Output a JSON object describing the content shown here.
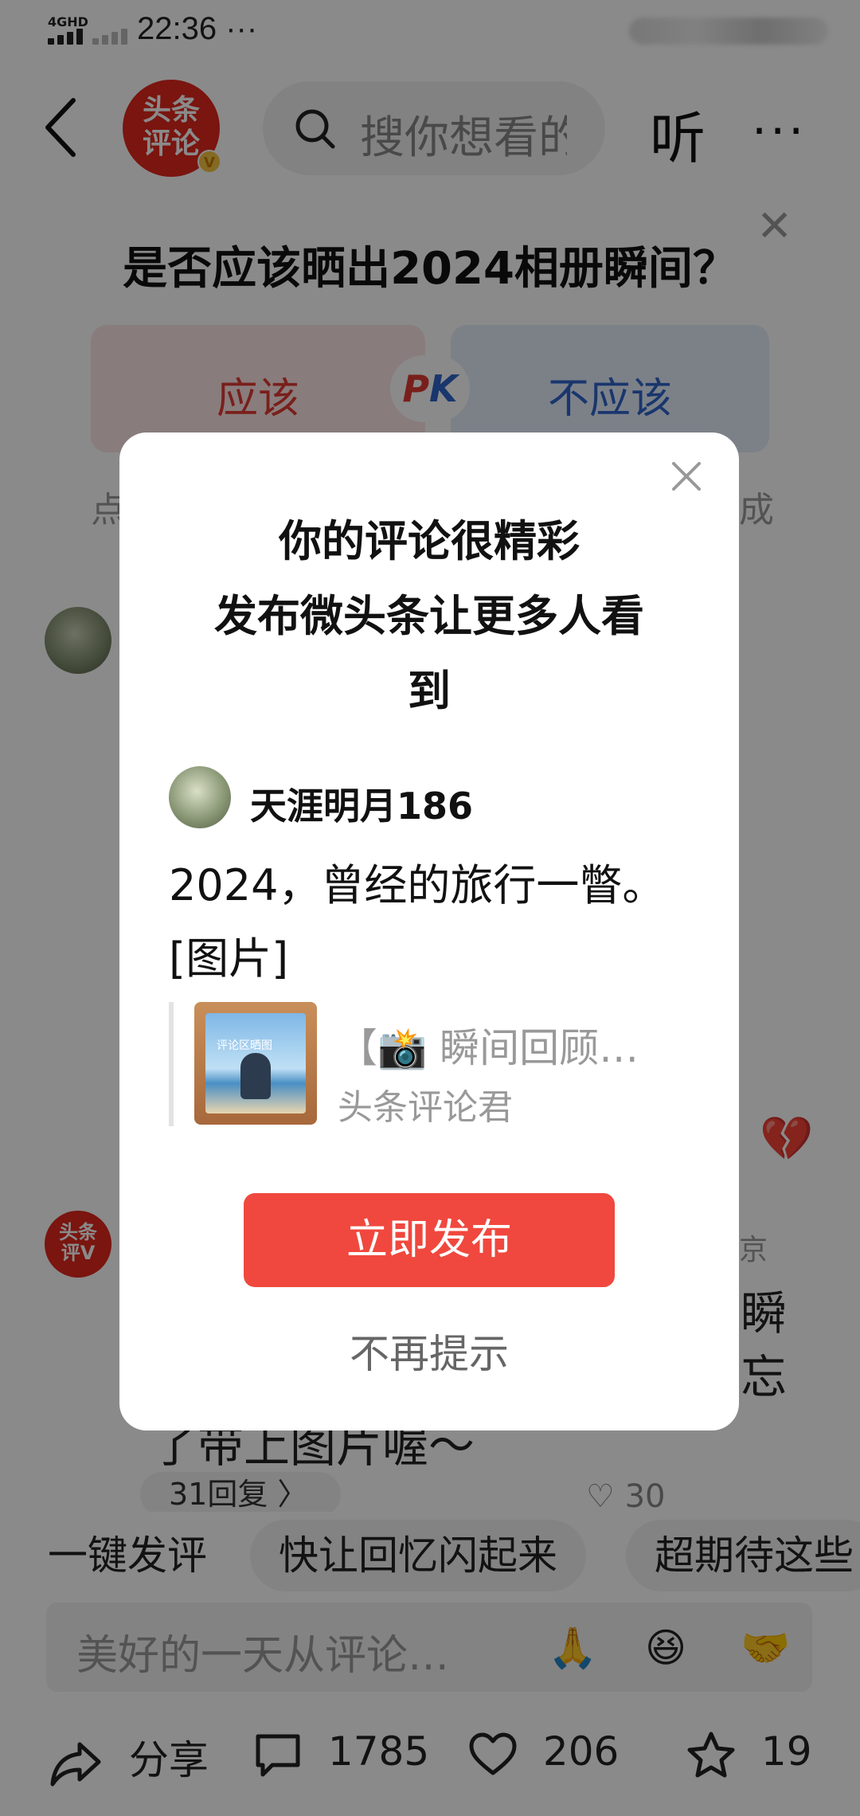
{
  "status_bar": {
    "network": "4GHD",
    "time": "22:36",
    "dots": "···"
  },
  "header": {
    "logo_text": "头条\n评论",
    "verified_mark": "V",
    "search_placeholder": "搜你想看的",
    "listen_label": "听",
    "more_label": "···"
  },
  "pk": {
    "question": "是否应该晒出2024相册瞬间？",
    "option_yes": "应该",
    "option_no": "不应该",
    "badge_p": "P",
    "badge_k": "K",
    "sub_left": "点",
    "sub_right": "成"
  },
  "background_comments": {
    "second_avatar_text": "头条\n评V",
    "side_text_1": "京",
    "side_text_2": "瞬",
    "side_text_3": "忘",
    "partial_line": "了带上图片喔～",
    "reply_pill": "31回复 〉",
    "like_count": "30"
  },
  "chips": [
    "一键发评",
    "快让回忆闪起来",
    "超期待这些"
  ],
  "comment_input": {
    "placeholder": "美好的一天从评论…",
    "emojis": [
      "🙏",
      "😆",
      "🤝"
    ]
  },
  "bottom_bar": {
    "share_label": "分享",
    "comments_count": "1785",
    "likes_count": "206",
    "favorites_count": "19"
  },
  "modal": {
    "title_line1": "你的评论很精彩",
    "title_line2": "发布微头条让更多人看",
    "title_line3": "到",
    "user_name": "天涯明月186",
    "comment_text": "2024，曾经的旅行一瞥。",
    "comment_image_tag": "[图片]",
    "share_title": "【📸 瞬间回顾…",
    "share_source": "头条评论君",
    "thumb_caption": "评论区晒图",
    "publish_button": "立即发布",
    "dismiss_label": "不再提示"
  },
  "colors": {
    "brand_red": "#e2271d",
    "button_red": "#f0483e",
    "pk_blue": "#2f64c9"
  }
}
